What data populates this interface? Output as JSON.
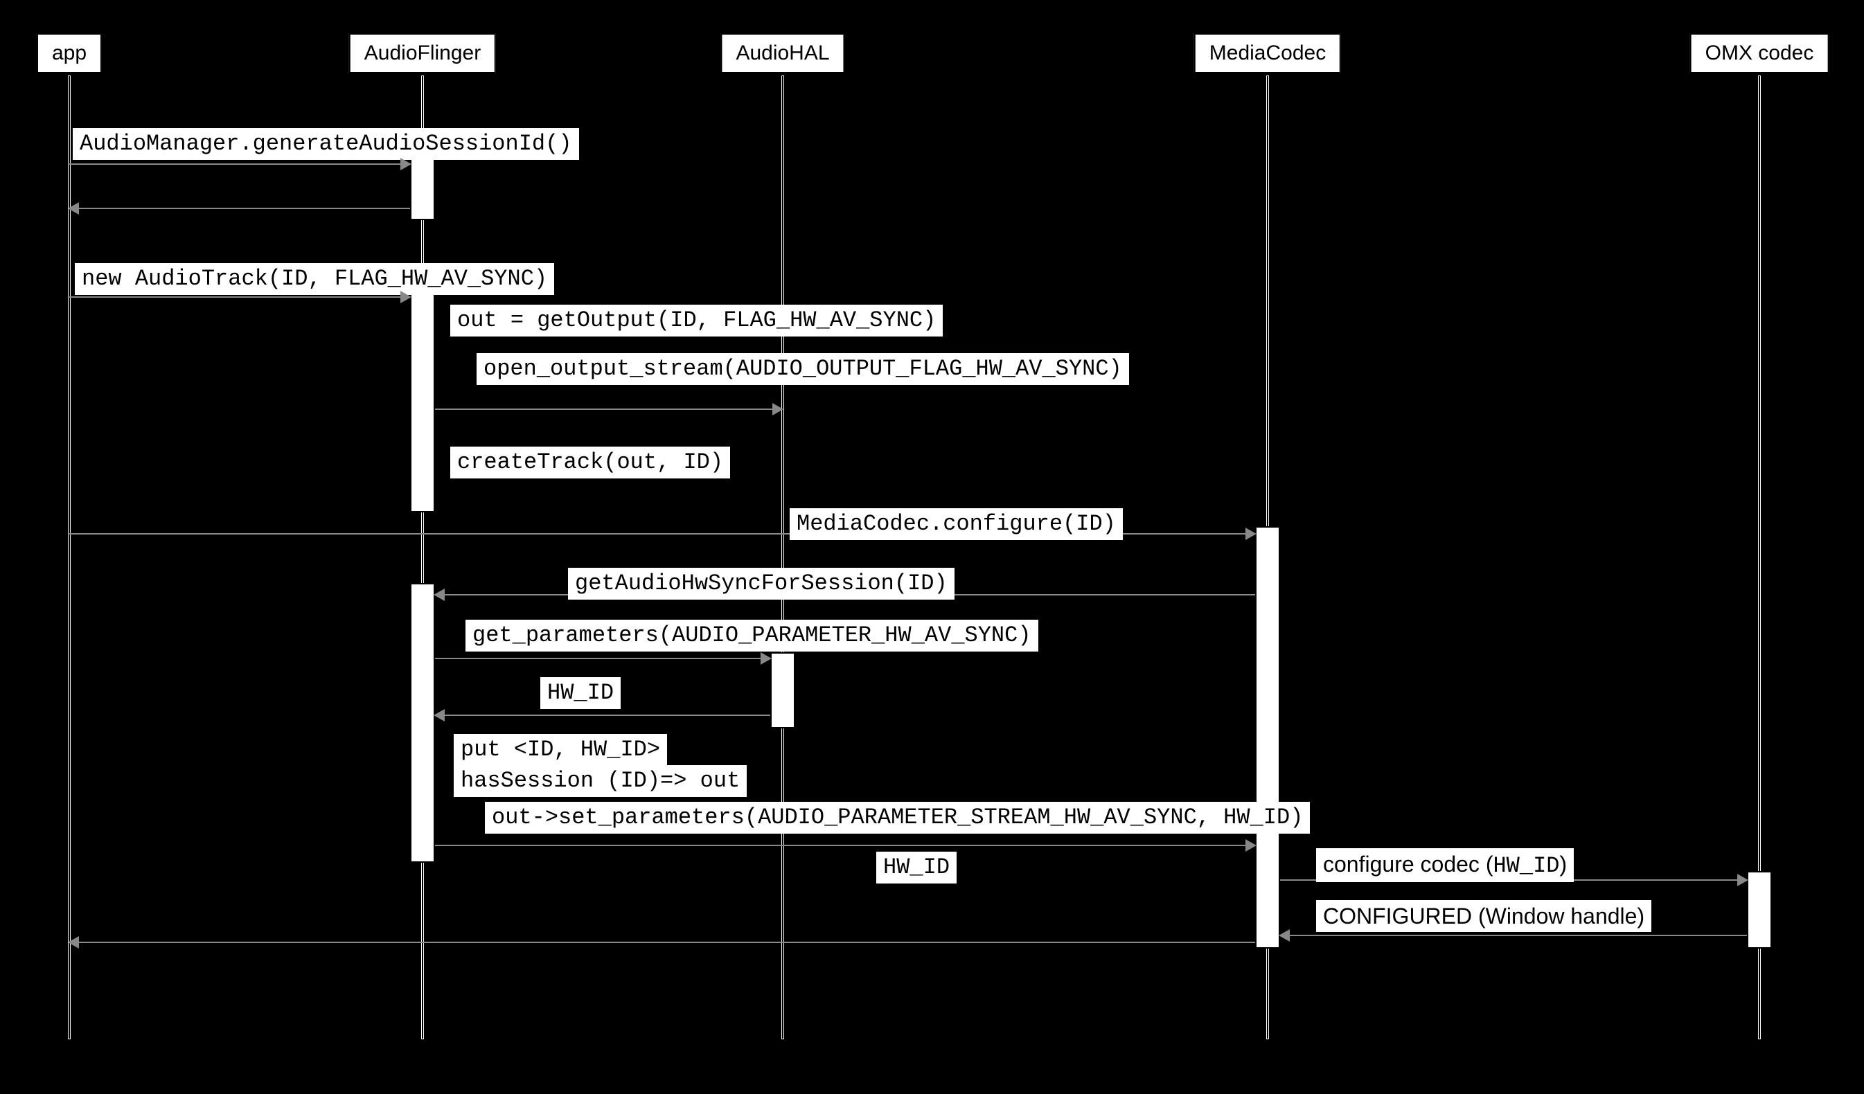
{
  "diagram": {
    "participants": {
      "app": "app",
      "audioflinger": "AudioFlinger",
      "audiohal": "AudioHAL",
      "mediacodec": "MediaCodec",
      "omx": "OMX codec"
    },
    "messages": {
      "m1": "AudioManager.generateAudioSessionId()",
      "m2": "new AudioTrack(ID, FLAG_HW_AV_SYNC)",
      "m3": "out = getOutput(ID, FLAG_HW_AV_SYNC)",
      "m4": "open_output_stream(AUDIO_OUTPUT_FLAG_HW_AV_SYNC)",
      "m5": "createTrack(out, ID)",
      "m6": "MediaCodec.configure(ID)",
      "m7": "getAudioHwSyncForSession(ID)",
      "m8": "get_parameters(AUDIO_PARAMETER_HW_AV_SYNC)",
      "m9": "HW_ID",
      "m10a": "put <ID, HW_ID>",
      "m10b": "hasSession (ID)=> out",
      "m11": "out->set_parameters(AUDIO_PARAMETER_STREAM_HW_AV_SYNC, HW_ID)",
      "m12": "HW_ID",
      "m13_pre": "configure codec (",
      "m13_code": "HW_ID",
      "m13_post": ")",
      "m14": "CONFIGURED (Window handle)"
    }
  }
}
